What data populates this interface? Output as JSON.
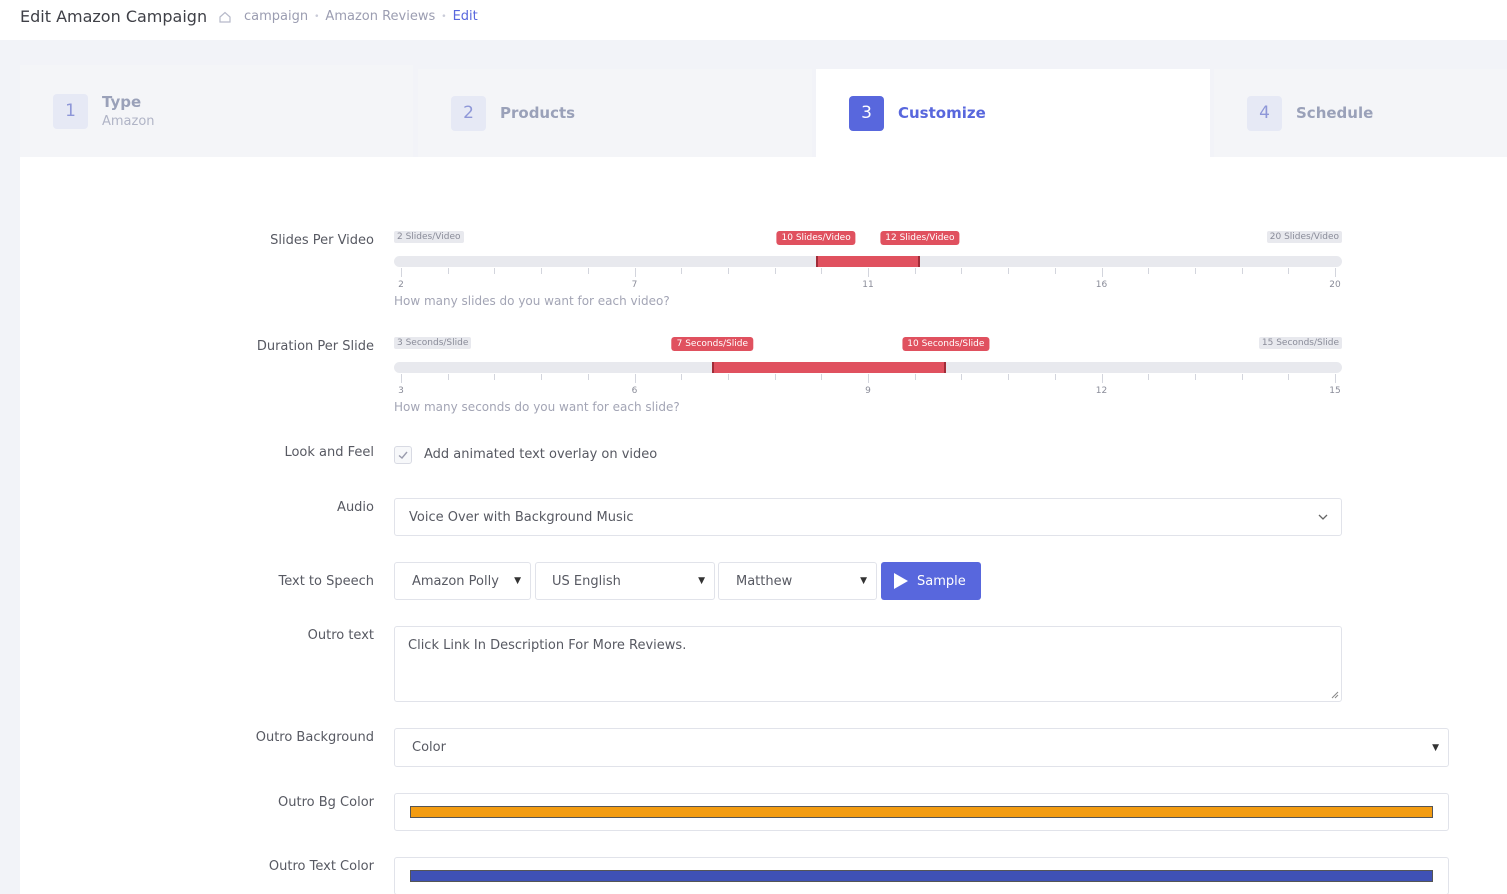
{
  "header": {
    "title": "Edit Amazon Campaign",
    "breadcrumb": [
      "campaign",
      "Amazon Reviews",
      "Edit"
    ]
  },
  "wizard": {
    "steps": [
      {
        "num": "1",
        "label": "Type",
        "sub": "Amazon"
      },
      {
        "num": "2",
        "label": "Products",
        "sub": ""
      },
      {
        "num": "3",
        "label": "Customize",
        "sub": ""
      },
      {
        "num": "4",
        "label": "Schedule",
        "sub": ""
      }
    ],
    "active_step": 3
  },
  "form": {
    "slides_per_video": {
      "label": "Slides Per Video",
      "min_label": "2 Slides/Video",
      "max_label": "20 Slides/Video",
      "from_label": "10 Slides/Video",
      "to_label": "12 Slides/Video",
      "min": 2,
      "max": 20,
      "from": 10,
      "to": 12,
      "ticks": [
        "2",
        "7",
        "11",
        "16",
        "20"
      ],
      "help": "How many slides do you want for each video?"
    },
    "duration_per_slide": {
      "label": "Duration Per Slide",
      "min_label": "3 Seconds/Slide",
      "max_label": "15 Seconds/Slide",
      "from_label": "7 Seconds/Slide",
      "to_label": "10 Seconds/Slide",
      "min": 3,
      "max": 15,
      "from": 7,
      "to": 10,
      "ticks": [
        "3",
        "6",
        "9",
        "12",
        "15"
      ],
      "help": "How many seconds do you want for each slide?"
    },
    "look_and_feel": {
      "label": "Look and Feel",
      "checkbox_label": "Add animated text overlay on video",
      "checked": true
    },
    "audio": {
      "label": "Audio",
      "value": "Voice Over with Background Music"
    },
    "tts": {
      "label": "Text to Speech",
      "engine": "Amazon Polly",
      "language": "US English",
      "voice": "Matthew",
      "sample_label": "Sample"
    },
    "outro_text": {
      "label": "Outro text",
      "value": "Click Link In Description For More Reviews."
    },
    "outro_background": {
      "label": "Outro Background",
      "value": "Color"
    },
    "outro_bg_color": {
      "label": "Outro Bg Color",
      "color": "#f39c12"
    },
    "outro_text_color": {
      "label": "Outro Text Color",
      "color": "#3f51b5"
    }
  },
  "colors": {
    "accent": "#5867dd",
    "range": "#e0515f"
  }
}
